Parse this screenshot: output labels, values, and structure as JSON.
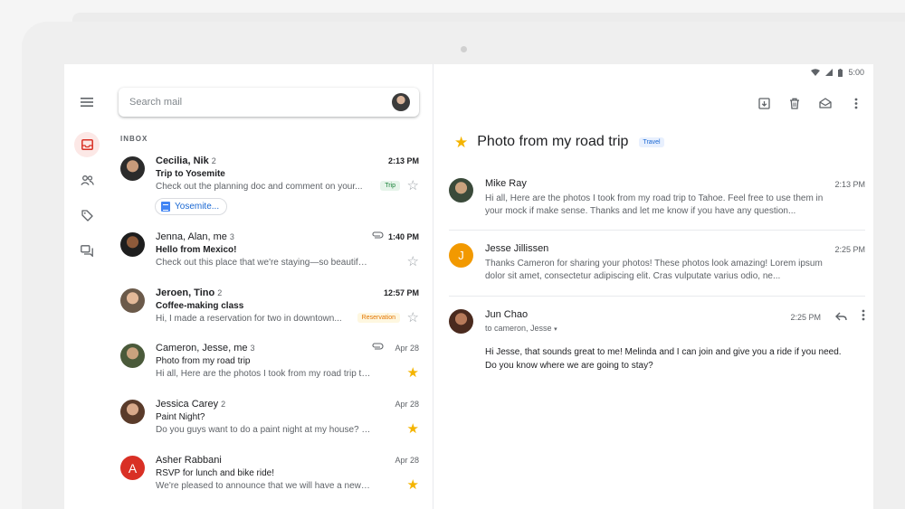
{
  "status": {
    "time": "5:00"
  },
  "search": {
    "placeholder": "Search mail"
  },
  "list": {
    "section_label": "INBOX",
    "mails": [
      {
        "sender": "Cecilia, Nik",
        "count": "2",
        "subject": "Trip to Yosemite",
        "snippet": "Check out the planning doc and comment on your...",
        "time": "2:13 PM",
        "tag": "Trip",
        "chip": "Yosemite...",
        "starred": false
      },
      {
        "sender": "Jenna, Alan, me",
        "count": "3",
        "subject": "Hello from Mexico!",
        "snippet": "Check out this place that we're staying—so beautiful! We...",
        "time": "1:40 PM",
        "starred": false
      },
      {
        "sender": "Jeroen, Tino",
        "count": "2",
        "subject": "Coffee-making class",
        "snippet": "Hi, I made a reservation for two in downtown...",
        "time": "12:57 PM",
        "tag": "Reservation",
        "starred": false
      },
      {
        "sender": "Cameron, Jesse, me",
        "count": "3",
        "subject": "Photo from my road trip",
        "snippet": "Hi all, Here are the photos I took from my road trip to Ta...",
        "time": "Apr 28",
        "starred": true
      },
      {
        "sender": "Jessica Carey",
        "count": "2",
        "subject": "Paint Night?",
        "snippet": "Do you guys want to do a paint night at my house? I'm th...",
        "time": "Apr 28",
        "starred": true
      },
      {
        "sender": "Asher Rabbani",
        "count": "",
        "subject": "RSVP for lunch and bike ride!",
        "snippet": "We're pleased to announce that we will have a new plan...",
        "time": "Apr 28",
        "starred": true,
        "initial": "A"
      }
    ]
  },
  "thread": {
    "title": "Photo from my road trip",
    "label": "Travel",
    "messages": [
      {
        "sender": "Mike Ray",
        "time": "2:13 PM",
        "body": "Hi all, Here are the photos I took from my road trip to Tahoe. Feel free to use them in your mock if make sense. Thanks and let me know if you have any question..."
      },
      {
        "sender": "Jesse Jillissen",
        "time": "2:25 PM",
        "initial": "J",
        "body": "Thanks Cameron for sharing your photos! These photos look amazing! Lorem ipsum dolor sit amet, consectetur adipiscing elit. Cras vulputate varius odio, ne..."
      },
      {
        "sender": "Jun Chao",
        "time": "2:25 PM",
        "to": "to cameron, Jesse",
        "body": "Hi Jesse, that sounds great to me! Melinda and I can join and give you a ride if you need. Do you know where we are going to stay?"
      }
    ]
  },
  "colors": {
    "accent": "#1a73e8",
    "star": "#f4b400",
    "red": "#d93025",
    "orange": "#f29900"
  },
  "icons": [
    "menu-icon",
    "inbox-icon",
    "people-icon",
    "label-icon",
    "chat-icon",
    "archive-icon",
    "delete-icon",
    "mark-unread-icon",
    "more-vert-icon",
    "reply-icon",
    "attachment-icon",
    "star-icon",
    "wifi-icon",
    "signal-icon",
    "battery-icon"
  ]
}
